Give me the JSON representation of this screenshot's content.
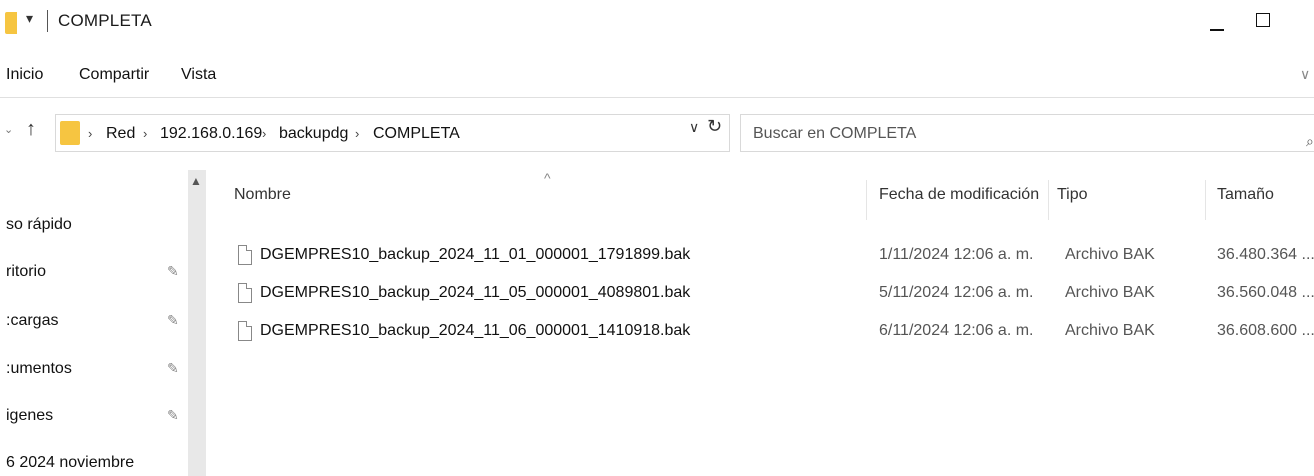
{
  "window": {
    "title": "COMPLETA",
    "quick_access_glyph": "▾"
  },
  "ribbon": {
    "tabs": [
      "Inicio",
      "Compartir",
      "Vista"
    ],
    "expand_glyph": "∨"
  },
  "navigation": {
    "recent_glyph": "⌄",
    "up_glyph": "↑",
    "breadcrumb": [
      "Red",
      "192.168.0.169",
      "backupdg",
      "COMPLETA"
    ],
    "separator": "›",
    "dropdown_glyph": "∨",
    "refresh_glyph": "↻"
  },
  "search": {
    "placeholder": "Buscar en COMPLETA",
    "icon": "search-icon"
  },
  "sidebar": {
    "items": [
      {
        "label": "so rápido",
        "pinned": false
      },
      {
        "label": "ritorio",
        "pinned": true
      },
      {
        "label": ":cargas",
        "pinned": true
      },
      {
        "label": ":umentos",
        "pinned": true
      },
      {
        "label": "igenes",
        "pinned": true
      },
      {
        "label": "6 2024 noviembre",
        "pinned": false
      }
    ],
    "pin_glyph": "📌"
  },
  "filelist": {
    "sort_glyph": "^",
    "columns": {
      "name": "Nombre",
      "date": "Fecha de modificación",
      "type": "Tipo",
      "size": "Tamaño"
    },
    "rows": [
      {
        "name": "DGEMPRES10_backup_2024_11_01_000001_1791899.bak",
        "date": "1/11/2024 12:06 a. m.",
        "type": "Archivo BAK",
        "size": "36.480.364 ..."
      },
      {
        "name": "DGEMPRES10_backup_2024_11_05_000001_4089801.bak",
        "date": "5/11/2024 12:06 a. m.",
        "type": "Archivo BAK",
        "size": "36.560.048 ..."
      },
      {
        "name": "DGEMPRES10_backup_2024_11_06_000001_1410918.bak",
        "date": "6/11/2024 12:06 a. m.",
        "type": "Archivo BAK",
        "size": "36.608.600 ..."
      }
    ]
  },
  "colors": {
    "folder": "#f6c541",
    "text": "#111111",
    "muted_text": "#555555"
  }
}
